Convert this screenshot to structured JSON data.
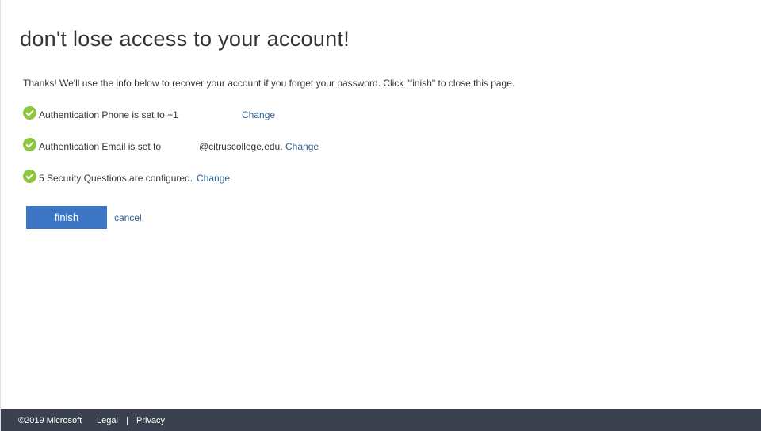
{
  "page": {
    "title": "don't lose access to your account!",
    "intro": "Thanks! We'll use the info below to recover your account if you forget your password. Click \"finish\" to close this page."
  },
  "status_rows": [
    {
      "text": "Authentication Phone is set to +1",
      "link": "Change",
      "icon": "check-circle-icon"
    },
    {
      "text": "Authentication Email is set to",
      "email_domain": "@citruscollege.edu.",
      "link": "Change",
      "icon": "check-circle-icon"
    },
    {
      "text": "5 Security Questions are configured.",
      "link": "Change",
      "icon": "check-circle-icon"
    }
  ],
  "actions": {
    "finish_label": "finish",
    "cancel_label": "cancel"
  },
  "footer": {
    "copyright": "©2019 Microsoft",
    "legal": "Legal",
    "separator": "|",
    "privacy": "Privacy"
  },
  "colors": {
    "accent": "#3b75c3",
    "link": "#2f5f91",
    "success": "#8cc63f",
    "footer_bg": "#3b414f"
  }
}
